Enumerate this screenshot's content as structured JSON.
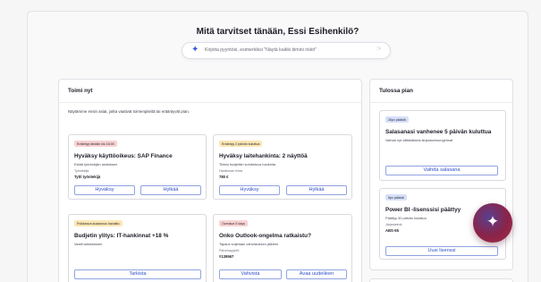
{
  "hero": {
    "title": "Mitä tarvitset tänään, Essi Esihenkilö?",
    "placeholder": "Kirjoita pyyntösi, esimerkiksi \"Näytä kaikki tiimini riskit\"",
    "send_hint": ":>"
  },
  "act_now": {
    "title": "Toimi nyt",
    "intro": "Näytämme ensin asiat, jotka vaativat toimenpiteitä tai erääntyvät pian.",
    "cards": [
      {
        "badge": "Erääntyy tänään klo 16:00",
        "title": "Hyväksy käyttöoikeus: SAP Finance",
        "subtitle": "Estää työntekijän aloituksen",
        "label": "Työntekijä",
        "value": "Tytti työntekijä",
        "primary": "Hyväksy",
        "secondary": "Hylkää"
      },
      {
        "badge": "Erääntyy 2 päivän kuluttua",
        "title": "Hyväksy laitehankinta: 2 näyttöä",
        "subtitle": "Tiimisi budjettiin kohdistuva hankinta",
        "label": "Hankinnan hinta",
        "value": "780 €",
        "primary": "Hyväksy",
        "secondary": "Hylkää"
      },
      {
        "badge": "Poikkeava kustannus havaittu",
        "title": "Budjetin ylitys: IT-hankinnat +18 %",
        "subtitle": "Vaatii tarkistuksen",
        "primary": "Tarkista"
      },
      {
        "badge": "Ovenkue 5 days",
        "title": "Onko Outlook-ongelma ratkaistu?",
        "subtitle": "Tapaus suljetaan vahvistuksen jälkeen",
        "label": "Palvelupyyntö",
        "value": "#139567",
        "primary": "Vahvista",
        "secondary": "Avaa uudelleen"
      }
    ]
  },
  "upcoming": {
    "title": "Tulossa pian",
    "cards": [
      {
        "badge": "30pv päästä",
        "title": "Salasanasi vanhenee 5 päivän kuluttua",
        "subtitle": "Vaihda nyt välttääksesi kirjautumisongelmat",
        "primary": "Vaihda salasana"
      },
      {
        "badge": "5pv päästä",
        "title": "Power BI -lisenssisi päättyy",
        "subtitle": "Päättyy 30 päivän kuluttua",
        "label": "Järjestelmä",
        "value": "ABS-55",
        "primary": "Uusi lisenssi"
      }
    ]
  },
  "assistant": {
    "icon": "sparkle-icon",
    "accent": "#8a2448"
  },
  "colors": {
    "link": "#2f4fc9",
    "badge_red": "#f9d2d2",
    "badge_yellow": "#fbe7b3",
    "badge_blue": "#d6e0fa"
  }
}
